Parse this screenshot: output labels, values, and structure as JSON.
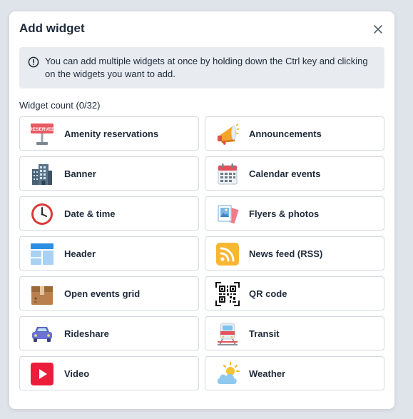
{
  "dialog": {
    "title": "Add widget",
    "info_text": "You can add multiple widgets at once by holding down the Ctrl key and clicking on the widgets you want to add.",
    "count_label": "Widget count (0/32)"
  },
  "widgets": [
    {
      "label": "Amenity reservations",
      "icon": "reserved-sign-icon"
    },
    {
      "label": "Announcements",
      "icon": "megaphone-icon"
    },
    {
      "label": "Banner",
      "icon": "building-icon"
    },
    {
      "label": "Calendar events",
      "icon": "calendar-icon"
    },
    {
      "label": "Date & time",
      "icon": "clock-icon"
    },
    {
      "label": "Flyers & photos",
      "icon": "photos-icon"
    },
    {
      "label": "Header",
      "icon": "header-layout-icon"
    },
    {
      "label": "News feed (RSS)",
      "icon": "rss-icon"
    },
    {
      "label": "Open events grid",
      "icon": "box-icon"
    },
    {
      "label": "QR code",
      "icon": "qr-code-icon"
    },
    {
      "label": "Rideshare",
      "icon": "car-icon"
    },
    {
      "label": "Transit",
      "icon": "train-icon"
    },
    {
      "label": "Video",
      "icon": "play-icon"
    },
    {
      "label": "Weather",
      "icon": "weather-icon"
    }
  ],
  "colors": {
    "background": "#dfe4ea",
    "info_bg": "#e8ecf1",
    "text": "#1e2a3a",
    "card_border": "#d5dae0"
  }
}
